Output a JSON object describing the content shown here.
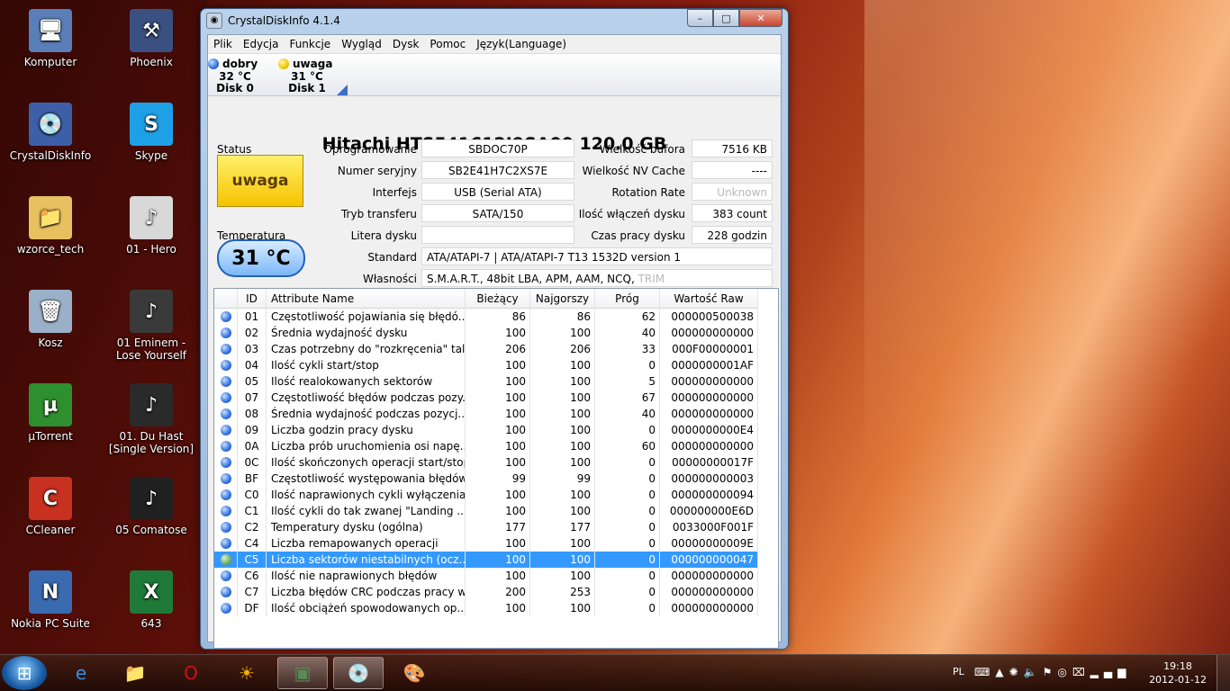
{
  "desktop": {
    "icons": [
      {
        "label": "Komputer",
        "glyph": "🖥"
      },
      {
        "label": "Phoenix",
        "glyph": "⚒"
      },
      {
        "label": "CrystalDiskInfo",
        "glyph": "💿"
      },
      {
        "label": "Skype",
        "glyph": "S"
      },
      {
        "label": "wzorce_tech",
        "glyph": "📁"
      },
      {
        "label": "01 - Hero",
        "glyph": "♪"
      },
      {
        "label": "Kosz",
        "glyph": "🗑"
      },
      {
        "label": "01 Eminem - Lose Yourself",
        "glyph": "♪"
      },
      {
        "label": "µTorrent",
        "glyph": "µ"
      },
      {
        "label": "01. Du Hast [Single Version]",
        "glyph": "♪"
      },
      {
        "label": "CCleaner",
        "glyph": "C"
      },
      {
        "label": "05 Comatose",
        "glyph": "♪"
      },
      {
        "label": "Nokia PC Suite",
        "glyph": "N"
      },
      {
        "label": "643",
        "glyph": "X"
      }
    ]
  },
  "window": {
    "title": "CrystalDiskInfo 4.1.4",
    "buttons": {
      "minimize": "–",
      "maximize": "□",
      "close": "✕"
    }
  },
  "menu": [
    "Plik",
    "Edycja",
    "Funkcje",
    "Wygląd",
    "Dysk",
    "Pomoc",
    "Język(Language)"
  ],
  "disks": [
    {
      "status": "dobry",
      "temp": "32 °C",
      "name": "Disk 0",
      "color": "blue"
    },
    {
      "status": "uwaga",
      "temp": "31 °C",
      "name": "Disk 1",
      "color": "yellow"
    }
  ],
  "model": "Hitachi HTS541612J9SA00  120.0 GB",
  "status": {
    "label": "Status",
    "value": "uwaga"
  },
  "temperature": {
    "label": "Temperatura",
    "value": "31 °C"
  },
  "fields": {
    "firmware": {
      "label": "Oprogramowanie",
      "value": "SBDOC70P"
    },
    "serial": {
      "label": "Numer seryjny",
      "value": "SB2E41H7C2XS7E"
    },
    "interface": {
      "label": "Interfejs",
      "value": "USB (Serial ATA)"
    },
    "transfer": {
      "label": "Tryb transferu",
      "value": "SATA/150"
    },
    "letter": {
      "label": "Litera dysku",
      "value": ""
    },
    "standard": {
      "label": "Standard",
      "value": "ATA/ATAPI-7 | ATA/ATAPI-7 T13 1532D version 1"
    },
    "features": {
      "label": "Własności",
      "value": "S.M.A.R.T., 48bit LBA, APM, AAM, NCQ, ",
      "value_gray": "TRIM"
    },
    "buffer": {
      "label": "Wielkość bufora",
      "value": "7516 KB"
    },
    "nvcache": {
      "label": "Wielkość NV Cache",
      "value": "----"
    },
    "rotation": {
      "label": "Rotation Rate",
      "value": "Unknown"
    },
    "powercount": {
      "label": "Ilość włączeń dysku",
      "value": "383 count"
    },
    "powerhours": {
      "label": "Czas pracy dysku",
      "value": "228 godzin"
    }
  },
  "table": {
    "headers": {
      "id": "ID",
      "name": "Attribute Name",
      "current": "Bieżący",
      "worst": "Najgorszy",
      "threshold": "Próg",
      "raw": "Wartość Raw"
    },
    "rows": [
      {
        "id": "01",
        "name": "Częstotliwość pojawiania się błędó...",
        "current": "86",
        "worst": "86",
        "threshold": "62",
        "raw": "000000500038"
      },
      {
        "id": "02",
        "name": "Średnia wydajność dysku",
        "current": "100",
        "worst": "100",
        "threshold": "40",
        "raw": "000000000000"
      },
      {
        "id": "03",
        "name": "Czas potrzebny do \"rozkręcenia\" tal...",
        "current": "206",
        "worst": "206",
        "threshold": "33",
        "raw": "000F00000001"
      },
      {
        "id": "04",
        "name": "Ilość cykli start/stop",
        "current": "100",
        "worst": "100",
        "threshold": "0",
        "raw": "0000000001AF"
      },
      {
        "id": "05",
        "name": "Ilość realokowanych sektorów",
        "current": "100",
        "worst": "100",
        "threshold": "5",
        "raw": "000000000000"
      },
      {
        "id": "07",
        "name": "Częstotliwość błędów podczas pozy...",
        "current": "100",
        "worst": "100",
        "threshold": "67",
        "raw": "000000000000"
      },
      {
        "id": "08",
        "name": "Średnia wydajność podczas pozycj...",
        "current": "100",
        "worst": "100",
        "threshold": "40",
        "raw": "000000000000"
      },
      {
        "id": "09",
        "name": "Liczba godzin pracy dysku",
        "current": "100",
        "worst": "100",
        "threshold": "0",
        "raw": "0000000000E4"
      },
      {
        "id": "0A",
        "name": "Liczba prób uruchomienia osi napę...",
        "current": "100",
        "worst": "100",
        "threshold": "60",
        "raw": "000000000000"
      },
      {
        "id": "0C",
        "name": "Ilość skończonych operacji start/stop",
        "current": "100",
        "worst": "100",
        "threshold": "0",
        "raw": "00000000017F"
      },
      {
        "id": "BF",
        "name": "Częstotliwość występowania błędów...",
        "current": "99",
        "worst": "99",
        "threshold": "0",
        "raw": "000000000003"
      },
      {
        "id": "C0",
        "name": "Ilość naprawionych cykli wyłączenia",
        "current": "100",
        "worst": "100",
        "threshold": "0",
        "raw": "000000000094"
      },
      {
        "id": "C1",
        "name": "Ilość cykli do tak zwanej \"Landing ...",
        "current": "100",
        "worst": "100",
        "threshold": "0",
        "raw": "000000000E6D"
      },
      {
        "id": "C2",
        "name": "Temperatury dysku (ogólna)",
        "current": "177",
        "worst": "177",
        "threshold": "0",
        "raw": "0033000F001F"
      },
      {
        "id": "C4",
        "name": "Liczba remapowanych operacji",
        "current": "100",
        "worst": "100",
        "threshold": "0",
        "raw": "00000000009E"
      },
      {
        "id": "C5",
        "name": "Liczba sektorów niestabilnych (ocz...",
        "current": "100",
        "worst": "100",
        "threshold": "0",
        "raw": "000000000047",
        "selected": true
      },
      {
        "id": "C6",
        "name": "Ilość nie naprawionych błędów",
        "current": "100",
        "worst": "100",
        "threshold": "0",
        "raw": "000000000000"
      },
      {
        "id": "C7",
        "name": "Liczba błędów CRC podczas pracy w...",
        "current": "200",
        "worst": "253",
        "threshold": "0",
        "raw": "000000000000"
      },
      {
        "id": "DF",
        "name": "Ilość obciążeń spowodowanych op...",
        "current": "100",
        "worst": "100",
        "threshold": "0",
        "raw": "000000000000"
      }
    ]
  },
  "taskbar": {
    "lang": "PL",
    "time": "19:18",
    "date": "2012-01-12",
    "apps": [
      {
        "name": "internet-explorer",
        "glyph": "e",
        "open": false
      },
      {
        "name": "explorer",
        "glyph": "📁",
        "open": false
      },
      {
        "name": "opera",
        "glyph": "O",
        "open": false
      },
      {
        "name": "sun",
        "glyph": "☀",
        "open": false
      },
      {
        "name": "monitor",
        "glyph": "▣",
        "open": true
      },
      {
        "name": "crystaldiskinfo",
        "glyph": "💿",
        "open": true
      },
      {
        "name": "paint",
        "glyph": "🎨",
        "open": false
      }
    ]
  },
  "colors": {
    "selection": "#3399ff",
    "status_warning": "#f5c400",
    "temp_blue": "#7ab8f8"
  }
}
